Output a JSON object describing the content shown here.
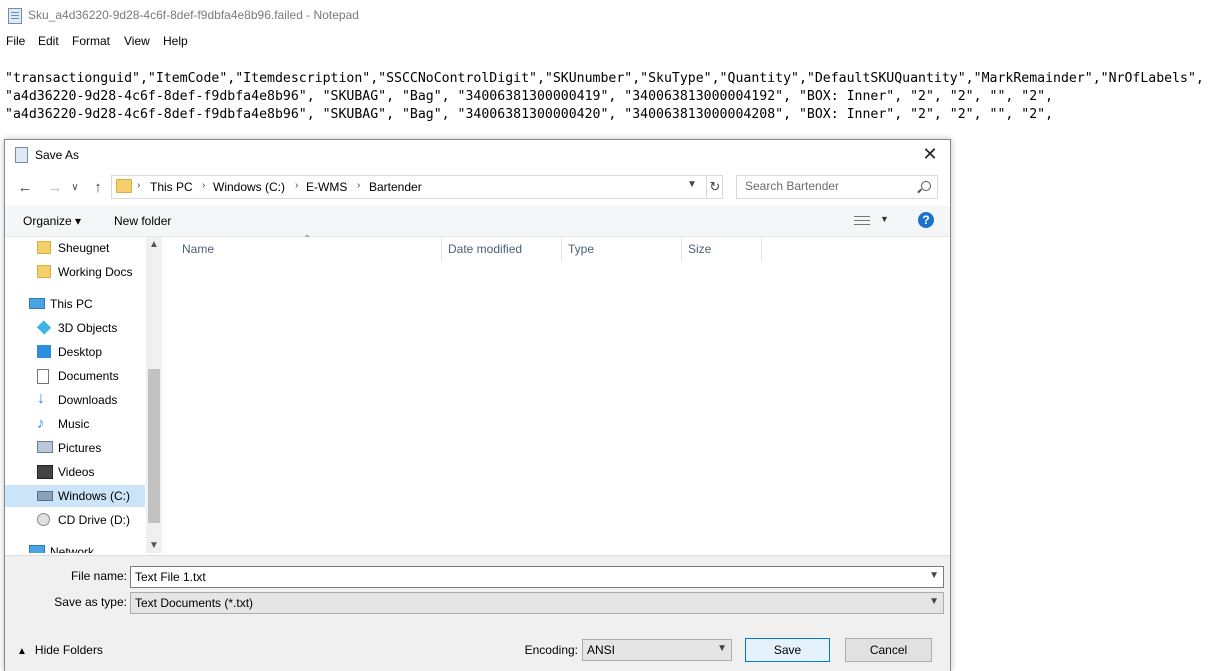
{
  "notepad": {
    "title": "Sku_a4d36220-9d28-4c6f-8def-f9dbfa4e8b96.failed - Notepad",
    "menu": [
      "File",
      "Edit",
      "Format",
      "View",
      "Help"
    ],
    "lines": [
      "\"transactionguid\",\"ItemCode\",\"Itemdescription\",\"SSCCNoControlDigit\",\"SKUnumber\",\"SkuType\",\"Quantity\",\"DefaultSKUQuantity\",\"MarkRemainder\",\"NrOfLabels\",",
      "\"a4d36220-9d28-4c6f-8def-f9dbfa4e8b96\", \"SKUBAG\", \"Bag\", \"34006381300000419\", \"340063813000004192\", \"BOX: Inner\", \"2\", \"2\", \"\", \"2\",",
      "\"a4d36220-9d28-4c6f-8def-f9dbfa4e8b96\", \"SKUBAG\", \"Bag\", \"34006381300000420\", \"340063813000004208\", \"BOX: Inner\", \"2\", \"2\", \"\", \"2\","
    ]
  },
  "dialog": {
    "title": "Save As",
    "close_glyph": "✕",
    "breadcrumb": [
      "This PC",
      "Windows (C:)",
      "E-WMS",
      "Bartender"
    ],
    "search_placeholder": "Search Bartender",
    "organize_label": "Organize ▾",
    "new_folder_label": "New folder",
    "help_glyph": "?",
    "nav_items": [
      {
        "label": "Sheugnet",
        "icon": "folder-icon"
      },
      {
        "label": "Working Docs",
        "icon": "folder-icon"
      },
      {
        "label": "This PC",
        "icon": "computer-icon"
      },
      {
        "label": "3D Objects",
        "icon": "3d-objects-icon"
      },
      {
        "label": "Desktop",
        "icon": "desktop-icon"
      },
      {
        "label": "Documents",
        "icon": "documents-icon"
      },
      {
        "label": "Downloads",
        "icon": "downloads-icon"
      },
      {
        "label": "Music",
        "icon": "music-icon"
      },
      {
        "label": "Pictures",
        "icon": "pictures-icon"
      },
      {
        "label": "Videos",
        "icon": "videos-icon"
      },
      {
        "label": "Windows (C:)",
        "icon": "drive-icon",
        "selected": true
      },
      {
        "label": "CD Drive (D:)",
        "icon": "cd-drive-icon"
      },
      {
        "label": "Network",
        "icon": "network-icon"
      }
    ],
    "columns": [
      "Name",
      "Date modified",
      "Type",
      "Size"
    ],
    "file_name_label": "File name:",
    "file_name_value": "Text File 1.txt",
    "save_type_label": "Save as type:",
    "save_type_value": "Text Documents (*.txt)",
    "hide_folders_label": "Hide Folders",
    "encoding_label": "Encoding:",
    "encoding_value": "ANSI",
    "save_label": "Save",
    "cancel_label": "Cancel"
  }
}
